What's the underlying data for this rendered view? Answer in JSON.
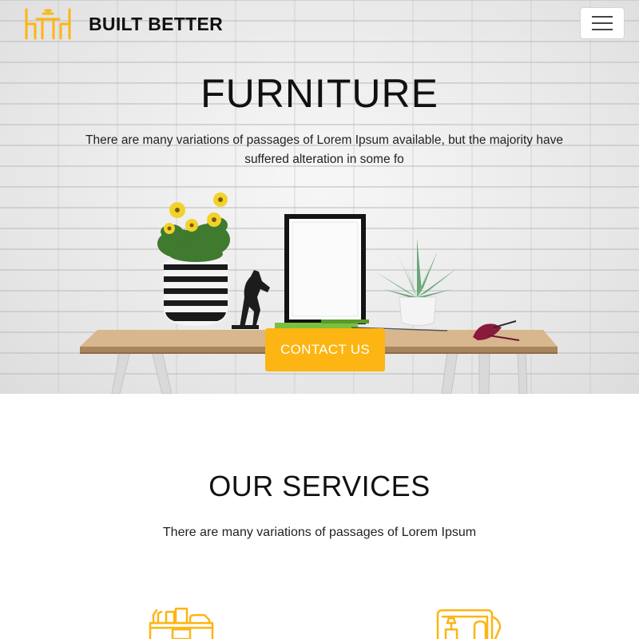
{
  "header": {
    "brand_name": "BUILT BETTER",
    "logo_icon": "table-chairs-icon",
    "menu_icon": "hamburger-menu-icon"
  },
  "hero": {
    "title": "FURNITURE",
    "text": "There are many variations of passages of Lorem Ipsum available, but the majority have suffered alteration in some fo",
    "cta_label": "CONTACT US"
  },
  "services": {
    "title": "OUR SERVICES",
    "text": "There are many variations of passages of Lorem Ipsum",
    "icons": [
      "desk-lamp-icon",
      "tablet-interior-icon"
    ]
  },
  "colors": {
    "accent": "#fcb512",
    "text": "#111111",
    "background": "#ffffff"
  }
}
